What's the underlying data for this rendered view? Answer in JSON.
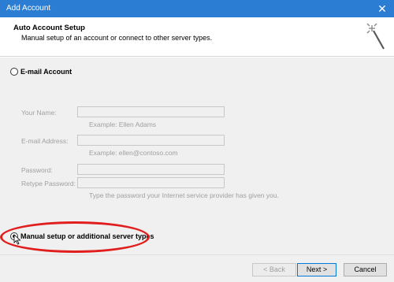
{
  "window": {
    "title": "Add Account",
    "close_glyph": "✕"
  },
  "header": {
    "title": "Auto Account Setup",
    "subtitle": "Manual setup of an account or connect to other server types.",
    "wizard_icon": "wizard-wand-icon"
  },
  "options": {
    "email_account": {
      "label": "E-mail Account",
      "selected": false
    },
    "manual_setup": {
      "label": "Manual setup or additional server types",
      "selected": true
    }
  },
  "form": {
    "name": {
      "label": "Your Name:",
      "value": "",
      "hint": "Example: Ellen Adams"
    },
    "email": {
      "label": "E-mail Address:",
      "value": "",
      "hint": "Example: ellen@contoso.com"
    },
    "password": {
      "label": "Password:",
      "value": ""
    },
    "retype_password": {
      "label": "Retype Password:",
      "value": "",
      "hint": "Type the password your Internet service provider has given you."
    }
  },
  "footer": {
    "back_label": "< Back",
    "next_label": "Next >",
    "cancel_label": "Cancel"
  },
  "colors": {
    "titlebar": "#2b7cd3",
    "annotation": "#e01e1e"
  }
}
